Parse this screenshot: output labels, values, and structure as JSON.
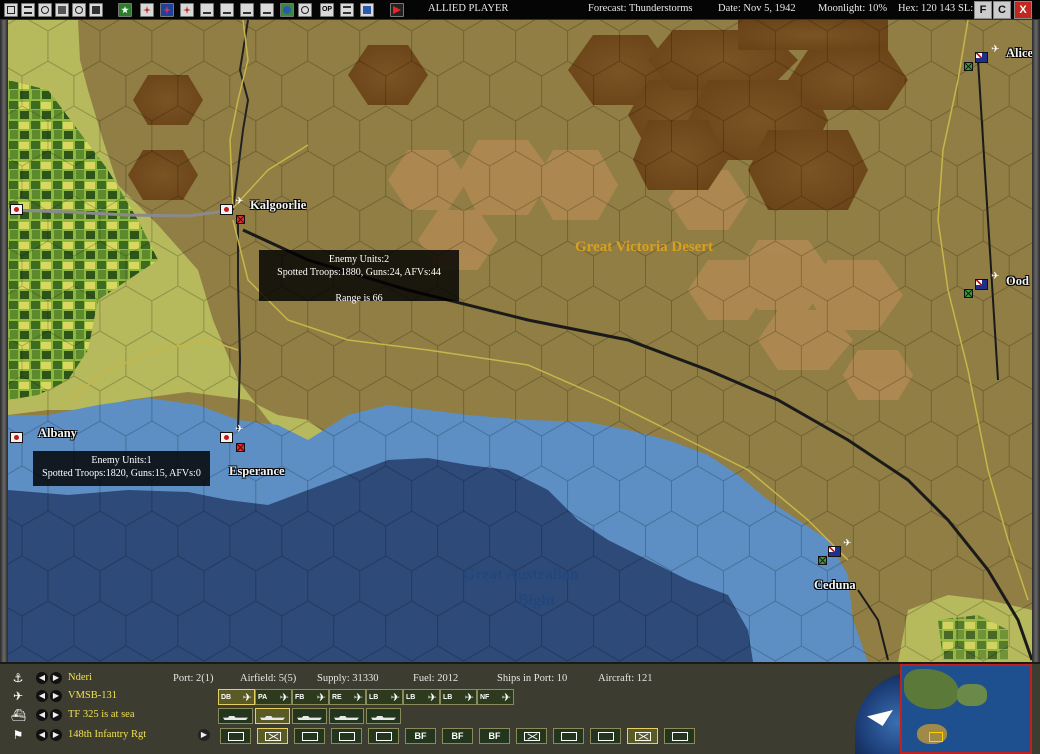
{
  "header": {
    "side": "ALLIED PLAYER",
    "forecast": "Forecast: Thunderstorms",
    "date": "Date: Nov 5, 1942",
    "moonlight": "Moonlight: 10%",
    "hex": "Hex: 120 143",
    "sl": "SL:",
    "toolbar_icons": [
      "save-icon",
      "list-icon",
      "eye-icon",
      "group-icon",
      "bases-icon",
      "hq-icon",
      "unit-icon",
      "squadron-icon",
      "ships-icon",
      "aircraft-icon",
      "production-icon",
      "research-icon",
      "globe-icon",
      "intel-icon",
      "op-icon",
      "report-icon",
      "display-icon",
      "end-turn-icon"
    ],
    "window_buttons": [
      "F",
      "C",
      "X"
    ]
  },
  "map": {
    "cities": [
      {
        "name": "Kalgoorlie"
      },
      {
        "name": "Albany"
      },
      {
        "name": "Esperance"
      },
      {
        "name": "Ceduna"
      },
      {
        "name": "Alice"
      },
      {
        "name": "Ood"
      }
    ],
    "regions": [
      {
        "name": "Great Victoria Desert",
        "color": "#d8a020"
      },
      {
        "name": "Great Australian",
        "color": "#23467c"
      },
      {
        "name": "Bight",
        "color": "#23467c"
      }
    ],
    "tooltips": {
      "kalgoorlie": {
        "line1": "Enemy Units:2",
        "line2": "Spotted Troops:1880, Guns:24, AFVs:44",
        "line3": "Range is 66"
      },
      "esperance": {
        "line1": "Enemy Units:1",
        "line2": "Spotted Troops:1820, Guns:15, AFVs:0"
      }
    }
  },
  "panel": {
    "rows": [
      {
        "icon": "anchor-icon",
        "label": "Nderi"
      },
      {
        "icon": "plane-icon",
        "label": "VMSB-131"
      },
      {
        "icon": "ship-icon",
        "label": "TF 325 is at sea"
      },
      {
        "icon": "flag-icon",
        "label": "148th Infantry Rgt"
      }
    ],
    "stats": {
      "port": "Port: 2(1)",
      "airfield": "Airfield: 5(5)",
      "supply": "Supply: 31330",
      "fuel": "Fuel: 2012",
      "ships": "Ships in Port: 10",
      "aircraft": "Aircraft: 121"
    },
    "aircraft_filters": [
      "DB",
      "PA",
      "FB",
      "RE",
      "LB",
      "LB",
      "LB",
      "NF"
    ],
    "ship_filters": [
      "ship-filter-1",
      "ship-filter-2",
      "ship-filter-3",
      "ship-filter-4",
      "ship-filter-5"
    ],
    "ground_filters": [
      "",
      "",
      "",
      "",
      "",
      "BF",
      "BF",
      "BF",
      "",
      "",
      "",
      ""
    ]
  },
  "colors": {
    "desert": "#8a7a42",
    "coastal_green": "#b8c060",
    "shallow_sea": "#5d8fc4",
    "deep_sea": "#2d4a78",
    "label_yellow": "#f0e050"
  }
}
